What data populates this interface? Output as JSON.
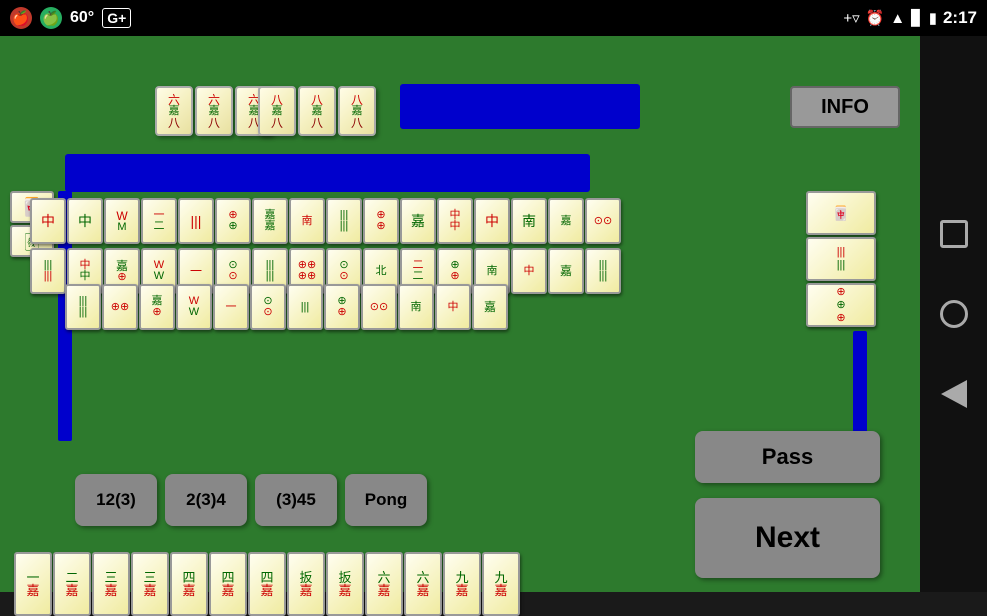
{
  "statusBar": {
    "temperature": "60°",
    "gplus": "G+",
    "time": "2:17"
  },
  "infoButton": {
    "label": "INFO"
  },
  "actionButtons": [
    {
      "label": "12(3)",
      "id": "btn-123"
    },
    {
      "label": "2(3)4",
      "id": "btn-234"
    },
    {
      "label": "(3)45",
      "id": "btn-345"
    },
    {
      "label": "Pong",
      "id": "btn-pong"
    }
  ],
  "passButton": {
    "label": "Pass"
  },
  "nextButton": {
    "label": "Next"
  },
  "topTileGroup1": [
    "六",
    "六",
    "八"
  ],
  "topTileGroup2": [
    "八",
    "八",
    "八"
  ],
  "bottomTiles": [
    "一",
    "二",
    "三",
    "三",
    "四",
    "四",
    "四",
    "扳",
    "扳",
    "六",
    "六",
    "九",
    "九"
  ],
  "navButtons": [
    "square",
    "circle",
    "back"
  ]
}
